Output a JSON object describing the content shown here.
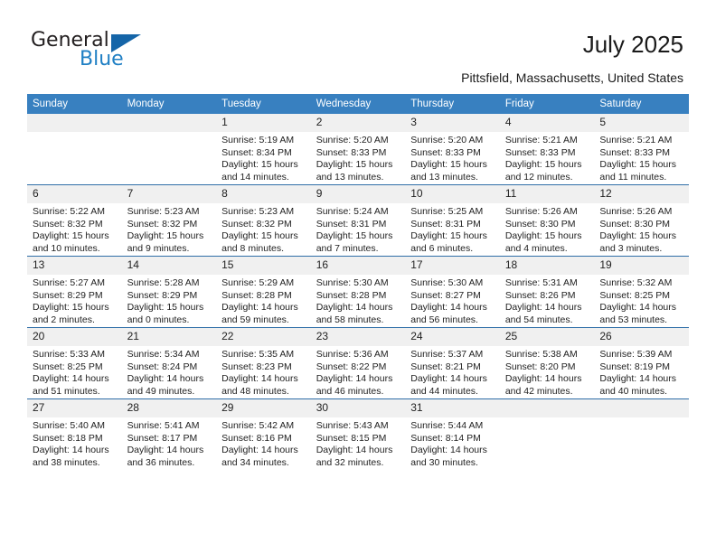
{
  "brand": {
    "name_top": "General",
    "name_bottom": "Blue"
  },
  "header": {
    "title": "July 2025",
    "location": "Pittsfield, Massachusetts, United States"
  },
  "calendar": {
    "weekday_headers": [
      "Sunday",
      "Monday",
      "Tuesday",
      "Wednesday",
      "Thursday",
      "Friday",
      "Saturday"
    ],
    "accent_color": "#3880c0",
    "row_divider_color": "#2f6ea8",
    "daynum_band_color": "#f0f0f0",
    "weeks": [
      [
        {
          "day": "",
          "sunrise": "",
          "sunset": "",
          "daylight_line1": "",
          "daylight_line2": ""
        },
        {
          "day": "",
          "sunrise": "",
          "sunset": "",
          "daylight_line1": "",
          "daylight_line2": ""
        },
        {
          "day": "1",
          "sunrise": "Sunrise: 5:19 AM",
          "sunset": "Sunset: 8:34 PM",
          "daylight_line1": "Daylight: 15 hours",
          "daylight_line2": "and 14 minutes."
        },
        {
          "day": "2",
          "sunrise": "Sunrise: 5:20 AM",
          "sunset": "Sunset: 8:33 PM",
          "daylight_line1": "Daylight: 15 hours",
          "daylight_line2": "and 13 minutes."
        },
        {
          "day": "3",
          "sunrise": "Sunrise: 5:20 AM",
          "sunset": "Sunset: 8:33 PM",
          "daylight_line1": "Daylight: 15 hours",
          "daylight_line2": "and 13 minutes."
        },
        {
          "day": "4",
          "sunrise": "Sunrise: 5:21 AM",
          "sunset": "Sunset: 8:33 PM",
          "daylight_line1": "Daylight: 15 hours",
          "daylight_line2": "and 12 minutes."
        },
        {
          "day": "5",
          "sunrise": "Sunrise: 5:21 AM",
          "sunset": "Sunset: 8:33 PM",
          "daylight_line1": "Daylight: 15 hours",
          "daylight_line2": "and 11 minutes."
        }
      ],
      [
        {
          "day": "6",
          "sunrise": "Sunrise: 5:22 AM",
          "sunset": "Sunset: 8:32 PM",
          "daylight_line1": "Daylight: 15 hours",
          "daylight_line2": "and 10 minutes."
        },
        {
          "day": "7",
          "sunrise": "Sunrise: 5:23 AM",
          "sunset": "Sunset: 8:32 PM",
          "daylight_line1": "Daylight: 15 hours",
          "daylight_line2": "and 9 minutes."
        },
        {
          "day": "8",
          "sunrise": "Sunrise: 5:23 AM",
          "sunset": "Sunset: 8:32 PM",
          "daylight_line1": "Daylight: 15 hours",
          "daylight_line2": "and 8 minutes."
        },
        {
          "day": "9",
          "sunrise": "Sunrise: 5:24 AM",
          "sunset": "Sunset: 8:31 PM",
          "daylight_line1": "Daylight: 15 hours",
          "daylight_line2": "and 7 minutes."
        },
        {
          "day": "10",
          "sunrise": "Sunrise: 5:25 AM",
          "sunset": "Sunset: 8:31 PM",
          "daylight_line1": "Daylight: 15 hours",
          "daylight_line2": "and 6 minutes."
        },
        {
          "day": "11",
          "sunrise": "Sunrise: 5:26 AM",
          "sunset": "Sunset: 8:30 PM",
          "daylight_line1": "Daylight: 15 hours",
          "daylight_line2": "and 4 minutes."
        },
        {
          "day": "12",
          "sunrise": "Sunrise: 5:26 AM",
          "sunset": "Sunset: 8:30 PM",
          "daylight_line1": "Daylight: 15 hours",
          "daylight_line2": "and 3 minutes."
        }
      ],
      [
        {
          "day": "13",
          "sunrise": "Sunrise: 5:27 AM",
          "sunset": "Sunset: 8:29 PM",
          "daylight_line1": "Daylight: 15 hours",
          "daylight_line2": "and 2 minutes."
        },
        {
          "day": "14",
          "sunrise": "Sunrise: 5:28 AM",
          "sunset": "Sunset: 8:29 PM",
          "daylight_line1": "Daylight: 15 hours",
          "daylight_line2": "and 0 minutes."
        },
        {
          "day": "15",
          "sunrise": "Sunrise: 5:29 AM",
          "sunset": "Sunset: 8:28 PM",
          "daylight_line1": "Daylight: 14 hours",
          "daylight_line2": "and 59 minutes."
        },
        {
          "day": "16",
          "sunrise": "Sunrise: 5:30 AM",
          "sunset": "Sunset: 8:28 PM",
          "daylight_line1": "Daylight: 14 hours",
          "daylight_line2": "and 58 minutes."
        },
        {
          "day": "17",
          "sunrise": "Sunrise: 5:30 AM",
          "sunset": "Sunset: 8:27 PM",
          "daylight_line1": "Daylight: 14 hours",
          "daylight_line2": "and 56 minutes."
        },
        {
          "day": "18",
          "sunrise": "Sunrise: 5:31 AM",
          "sunset": "Sunset: 8:26 PM",
          "daylight_line1": "Daylight: 14 hours",
          "daylight_line2": "and 54 minutes."
        },
        {
          "day": "19",
          "sunrise": "Sunrise: 5:32 AM",
          "sunset": "Sunset: 8:25 PM",
          "daylight_line1": "Daylight: 14 hours",
          "daylight_line2": "and 53 minutes."
        }
      ],
      [
        {
          "day": "20",
          "sunrise": "Sunrise: 5:33 AM",
          "sunset": "Sunset: 8:25 PM",
          "daylight_line1": "Daylight: 14 hours",
          "daylight_line2": "and 51 minutes."
        },
        {
          "day": "21",
          "sunrise": "Sunrise: 5:34 AM",
          "sunset": "Sunset: 8:24 PM",
          "daylight_line1": "Daylight: 14 hours",
          "daylight_line2": "and 49 minutes."
        },
        {
          "day": "22",
          "sunrise": "Sunrise: 5:35 AM",
          "sunset": "Sunset: 8:23 PM",
          "daylight_line1": "Daylight: 14 hours",
          "daylight_line2": "and 48 minutes."
        },
        {
          "day": "23",
          "sunrise": "Sunrise: 5:36 AM",
          "sunset": "Sunset: 8:22 PM",
          "daylight_line1": "Daylight: 14 hours",
          "daylight_line2": "and 46 minutes."
        },
        {
          "day": "24",
          "sunrise": "Sunrise: 5:37 AM",
          "sunset": "Sunset: 8:21 PM",
          "daylight_line1": "Daylight: 14 hours",
          "daylight_line2": "and 44 minutes."
        },
        {
          "day": "25",
          "sunrise": "Sunrise: 5:38 AM",
          "sunset": "Sunset: 8:20 PM",
          "daylight_line1": "Daylight: 14 hours",
          "daylight_line2": "and 42 minutes."
        },
        {
          "day": "26",
          "sunrise": "Sunrise: 5:39 AM",
          "sunset": "Sunset: 8:19 PM",
          "daylight_line1": "Daylight: 14 hours",
          "daylight_line2": "and 40 minutes."
        }
      ],
      [
        {
          "day": "27",
          "sunrise": "Sunrise: 5:40 AM",
          "sunset": "Sunset: 8:18 PM",
          "daylight_line1": "Daylight: 14 hours",
          "daylight_line2": "and 38 minutes."
        },
        {
          "day": "28",
          "sunrise": "Sunrise: 5:41 AM",
          "sunset": "Sunset: 8:17 PM",
          "daylight_line1": "Daylight: 14 hours",
          "daylight_line2": "and 36 minutes."
        },
        {
          "day": "29",
          "sunrise": "Sunrise: 5:42 AM",
          "sunset": "Sunset: 8:16 PM",
          "daylight_line1": "Daylight: 14 hours",
          "daylight_line2": "and 34 minutes."
        },
        {
          "day": "30",
          "sunrise": "Sunrise: 5:43 AM",
          "sunset": "Sunset: 8:15 PM",
          "daylight_line1": "Daylight: 14 hours",
          "daylight_line2": "and 32 minutes."
        },
        {
          "day": "31",
          "sunrise": "Sunrise: 5:44 AM",
          "sunset": "Sunset: 8:14 PM",
          "daylight_line1": "Daylight: 14 hours",
          "daylight_line2": "and 30 minutes."
        },
        {
          "day": "",
          "sunrise": "",
          "sunset": "",
          "daylight_line1": "",
          "daylight_line2": ""
        },
        {
          "day": "",
          "sunrise": "",
          "sunset": "",
          "daylight_line1": "",
          "daylight_line2": ""
        }
      ]
    ]
  }
}
